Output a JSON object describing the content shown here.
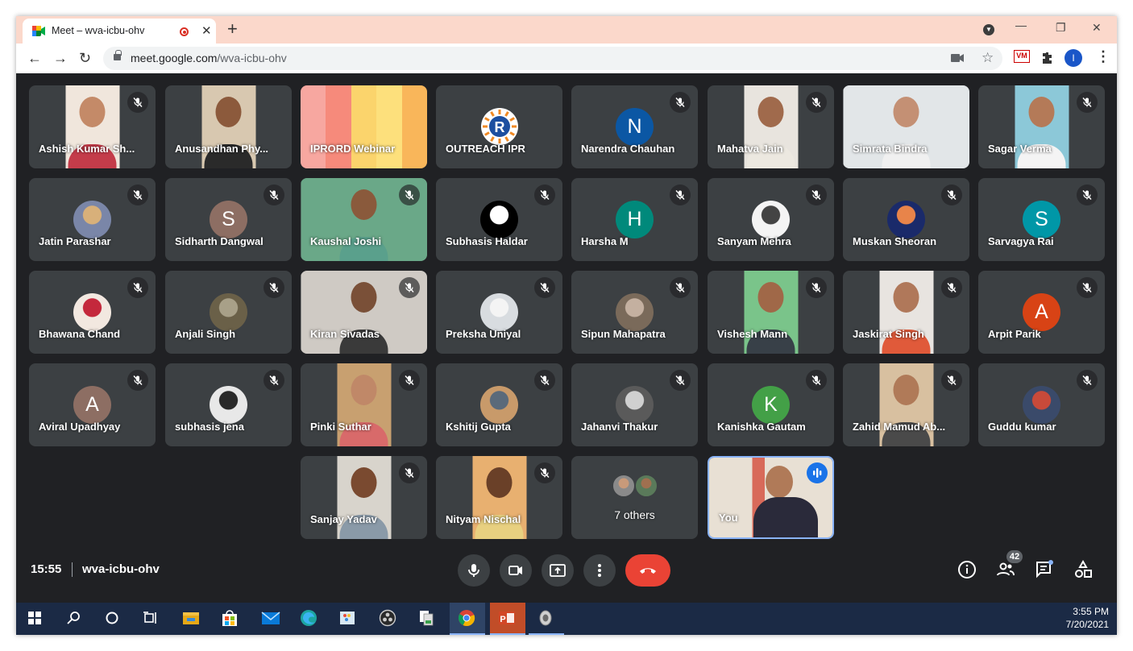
{
  "browser": {
    "tab_title": "Meet – wva-icbu-ohv",
    "tab_close": "✕",
    "new_tab": "+",
    "url_host": "meet.google.com",
    "url_path": "/wva-icbu-ohv",
    "profile_initial": "I",
    "extension_label": "VM"
  },
  "meeting": {
    "time": "15:55",
    "code": "wva-icbu-ohv",
    "participant_count": "42"
  },
  "tiles": [
    {
      "name": "Ashish Kumar Sh...",
      "kind": "video",
      "bg": "#f0e6dc",
      "skin": "#c48a68",
      "shirt": "#c43c4a",
      "muted": true
    },
    {
      "name": "Anusandhan Phy...",
      "kind": "video",
      "bg": "#d8c8b0",
      "skin": "#8c5a3c",
      "shirt": "#2a2a2a",
      "muted": false
    },
    {
      "name": "IPRORD Webinar",
      "kind": "stripes",
      "colors": [
        "#f7a7a0",
        "#f68a7b",
        "#fbd46c",
        "#fde07c",
        "#f9b65a"
      ],
      "muted": false
    },
    {
      "name": "OUTREACH IPR",
      "kind": "logo",
      "logo": "outreach-ipr-logo",
      "muted": false
    },
    {
      "name": "Narendra Chauhan",
      "kind": "avatar",
      "initial": "N",
      "color": "#0b57a4",
      "muted": true
    },
    {
      "name": "Mahatva Jain",
      "kind": "video",
      "bg": "#e8e4de",
      "skin": "#a06a4c",
      "shirt": "#ece8e0",
      "muted": true
    },
    {
      "name": "Simrata Bindra",
      "kind": "video-wide",
      "bg": "#e2e6e8",
      "skin": "#c49074",
      "shirt": "#f0f0f0",
      "muted": false
    },
    {
      "name": "Sagar Verma",
      "kind": "video",
      "bg": "#8cc8d8",
      "skin": "#b47a58",
      "shirt": "#f4f4f4",
      "muted": true
    },
    {
      "name": "Jatin Parashar",
      "kind": "avatar-img",
      "color": "#7a86a8",
      "color2": "#d8b07a",
      "muted": true
    },
    {
      "name": "Sidharth Dangwal",
      "kind": "avatar",
      "initial": "S",
      "color": "#8d6e63",
      "muted": true
    },
    {
      "name": "Kaushal Joshi",
      "kind": "video-wide",
      "bg": "#6aa888",
      "skin": "#8a5a3c",
      "shirt": "#5aa08c",
      "muted": true
    },
    {
      "name": "Subhasis Haldar",
      "kind": "avatar-img",
      "color": "#000000",
      "color2": "#ffffff",
      "muted": true
    },
    {
      "name": "Harsha M",
      "kind": "avatar",
      "initial": "H",
      "color": "#00897b",
      "muted": true
    },
    {
      "name": "Sanyam Mehra",
      "kind": "avatar-img",
      "color": "#f4f4f4",
      "color2": "#444444",
      "muted": true
    },
    {
      "name": "Muskan Sheoran",
      "kind": "avatar-img",
      "color": "#1a2a6a",
      "color2": "#e8844a",
      "muted": true
    },
    {
      "name": "Sarvagya Rai",
      "kind": "avatar",
      "initial": "S",
      "color": "#0097a7",
      "muted": true
    },
    {
      "name": "Bhawana Chand",
      "kind": "avatar-img",
      "color": "#f2e8e0",
      "color2": "#c4283c",
      "muted": true
    },
    {
      "name": "Anjali Singh",
      "kind": "avatar-img",
      "color": "#6a6048",
      "color2": "#a8a088",
      "muted": true
    },
    {
      "name": "Kiran Sivadas",
      "kind": "video-wide",
      "bg": "#cfcac4",
      "skin": "#7a5038",
      "shirt": "#3a3a3a",
      "muted": true
    },
    {
      "name": "Preksha Uniyal",
      "kind": "avatar-img",
      "color": "#d8dce0",
      "color2": "#f4f4f4",
      "muted": true
    },
    {
      "name": "Sipun Mahapatra",
      "kind": "avatar-img",
      "color": "#7a6a5a",
      "color2": "#c4b0a0",
      "muted": true
    },
    {
      "name": "Vishesh Mann",
      "kind": "video",
      "bg": "#7ac48a",
      "skin": "#a06848",
      "shirt": "#384048",
      "muted": true
    },
    {
      "name": "Jaskirat Singh",
      "kind": "video",
      "bg": "#e8e4e0",
      "skin": "#b0785a",
      "shirt": "#e05a3a",
      "muted": true
    },
    {
      "name": "Arpit Parik",
      "kind": "avatar",
      "initial": "A",
      "color": "#d84315",
      "muted": true
    },
    {
      "name": "Aviral Upadhyay",
      "kind": "avatar",
      "initial": "A",
      "color": "#8d6e63",
      "muted": true
    },
    {
      "name": "subhasis jena",
      "kind": "avatar-img",
      "color": "#e8e8e8",
      "color2": "#2a2a2a",
      "muted": true
    },
    {
      "name": "Pinki Suthar",
      "kind": "video",
      "bg": "#c8a070",
      "skin": "#c08868",
      "shirt": "#d86a6a",
      "muted": true
    },
    {
      "name": "Kshitij Gupta",
      "kind": "avatar-img",
      "color": "#c89a6a",
      "color2": "#5a6a7a",
      "muted": true
    },
    {
      "name": "Jahanvi Thakur",
      "kind": "avatar-img",
      "color": "#5a5a5a",
      "color2": "#d0d0d0",
      "muted": true
    },
    {
      "name": "Kanishka Gautam",
      "kind": "avatar",
      "initial": "K",
      "color": "#43a047",
      "muted": true
    },
    {
      "name": "Zahid Mamud Ab...",
      "kind": "video",
      "bg": "#d8c0a0",
      "skin": "#b07a58",
      "shirt": "#4a4a4a",
      "muted": true
    },
    {
      "name": "Guddu kumar",
      "kind": "avatar-img",
      "color": "#3a4a6a",
      "color2": "#c84a3a",
      "muted": true
    },
    {
      "name": "Sanjay Yadav",
      "kind": "video",
      "bg": "#d8d4cc",
      "skin": "#7a4a30",
      "shirt": "#8a9aa8",
      "muted": true
    },
    {
      "name": "Nityam Nischal",
      "kind": "video",
      "bg": "#e8b070",
      "skin": "#6a4028",
      "shirt": "#e8d080",
      "muted": true
    },
    {
      "name": "7 others",
      "kind": "others",
      "muted": false
    },
    {
      "name": "You",
      "kind": "self",
      "muted": false
    }
  ],
  "taskbar": {
    "time": "3:55 PM",
    "date": "7/20/2021",
    "ppt_label": "P"
  },
  "colors": {
    "meet_bg": "#202124",
    "tile_bg": "#3c4043",
    "end_call": "#ea4335",
    "speaking_border": "#8ab4f8",
    "taskbar": "#1b2a45",
    "tabbar": "#fbd8cb"
  }
}
